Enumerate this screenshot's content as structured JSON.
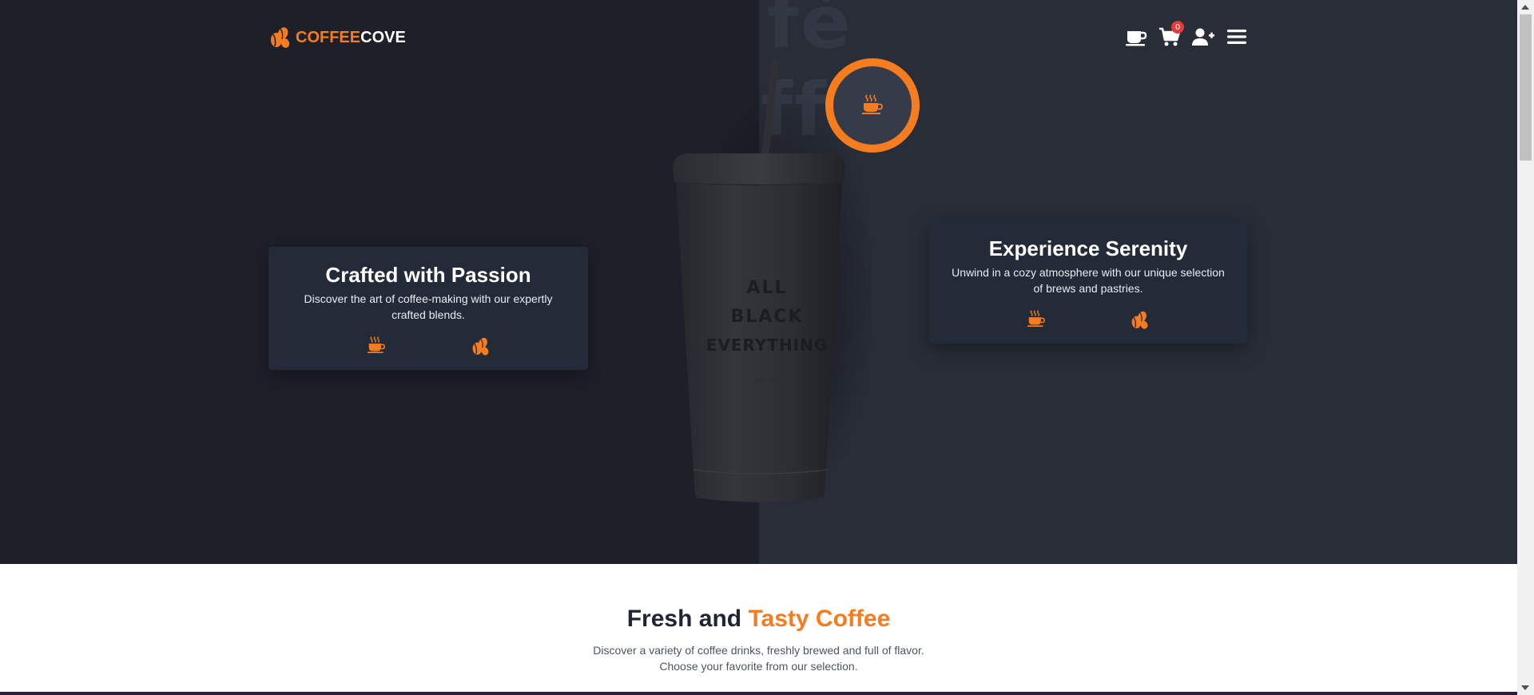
{
  "brand": {
    "part1": "COFFEE",
    "part2": "COVE"
  },
  "nav": {
    "cart_count": "0"
  },
  "hero": {
    "ghost_text_line1": "fé",
    "ghost_text_line2": "ff",
    "cup_lines": [
      "ALL",
      "BLACK",
      "EVERYTHING",
      "EST. 2019"
    ]
  },
  "cards": {
    "left": {
      "title": "Crafted with Passion",
      "text": "Discover the art of coffee-making with our expertly crafted blends."
    },
    "right": {
      "title": "Experience Serenity",
      "text": "Unwind in a cozy atmosphere with our unique selection of brews and pastries."
    }
  },
  "section": {
    "title_part1": "Fresh and ",
    "title_part2": "Tasty Coffee",
    "desc_line1": "Discover a variety of coffee drinks, freshly brewed and full of flavor.",
    "desc_line2": "Choose your favorite from our selection."
  },
  "colors": {
    "accent": "#f57c1f",
    "hero_dark": "#1d2028",
    "hero_right": "#292d38",
    "card_bg": "#232a38"
  },
  "icons": [
    "coffee-beans-icon",
    "coffee-cup-icon",
    "cart-icon",
    "add-user-icon",
    "menu-icon",
    "hot-coffee-icon"
  ]
}
